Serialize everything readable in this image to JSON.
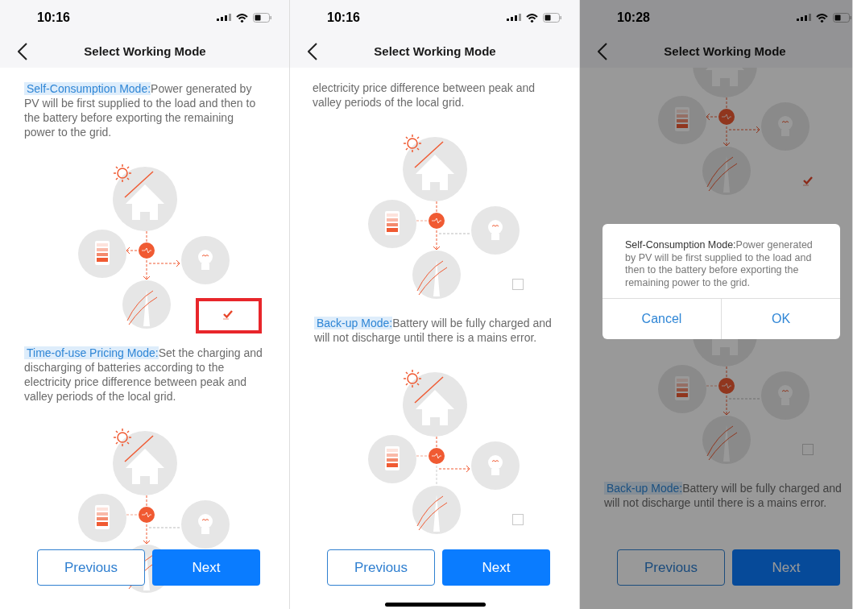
{
  "panels": [
    {
      "time": "10:16",
      "title": "Select Working Mode",
      "home_indicator": false,
      "dimmed": false,
      "items": [
        {
          "kind": "mode",
          "name": "Self-Consumption Mode:",
          "description": "Power generated by PV will be first supplied to the load and then to the battery before exporting the remaining power to the grid."
        },
        {
          "kind": "diagram",
          "battery_flow": true,
          "load_flow": true,
          "grid_flow": true,
          "checked": true,
          "highlighted": true
        },
        {
          "kind": "mode",
          "name": "Time-of-use Pricing Mode:",
          "description": "Set the charging and discharging of batteries according to the electricity price difference between peak and valley periods of the local grid."
        },
        {
          "kind": "diagram",
          "battery_flow": false,
          "load_flow": false,
          "grid_flow": true
        }
      ],
      "buttons": [
        {
          "label": "Previous",
          "kind": "outline"
        },
        {
          "label": "Next",
          "kind": "primary"
        }
      ]
    },
    {
      "time": "10:16",
      "title": "Select Working Mode",
      "home_indicator": true,
      "dimmed": false,
      "items": [
        {
          "kind": "text",
          "text": "electricity price difference between peak and valley periods of the local grid."
        },
        {
          "kind": "diagram",
          "battery_flow": false,
          "load_flow": false,
          "grid_flow": true,
          "checked": false,
          "highlighted": false
        },
        {
          "kind": "mode",
          "name": "Back-up Mode:",
          "description": "Battery will be fully charged and will not discharge until there is a mains error."
        },
        {
          "kind": "diagram",
          "battery_flow": false,
          "load_flow": true,
          "grid_flow": false,
          "checked": false,
          "highlighted": false
        }
      ],
      "buttons": [
        {
          "label": "Previous",
          "kind": "outline"
        },
        {
          "label": "Next",
          "kind": "primary"
        }
      ]
    },
    {
      "time": "10:28",
      "title": "Select Working Mode",
      "home_indicator": false,
      "dimmed": true,
      "items": [
        {
          "kind": "diagram",
          "battery_flow": true,
          "load_flow": true,
          "grid_flow": true,
          "checked": true,
          "highlighted": false
        },
        {
          "kind": "diagram",
          "battery_flow": false,
          "load_flow": false,
          "grid_flow": true,
          "checked": false,
          "highlighted": false
        },
        {
          "kind": "mode",
          "name": "Back-up Mode:",
          "description": "Battery will be fully charged and will not discharge until there is a mains error."
        }
      ],
      "buttons": [
        {
          "label": "Previous",
          "kind": "outline"
        },
        {
          "label": "Next",
          "kind": "primary"
        }
      ],
      "dialog": {
        "name": "Self-Consumption Mode:",
        "description": "Power generated by PV will be first supplied to the load and then to the battery before exporting the remaining power to the grid.",
        "buttons": [
          "Cancel",
          "OK"
        ]
      }
    }
  ]
}
